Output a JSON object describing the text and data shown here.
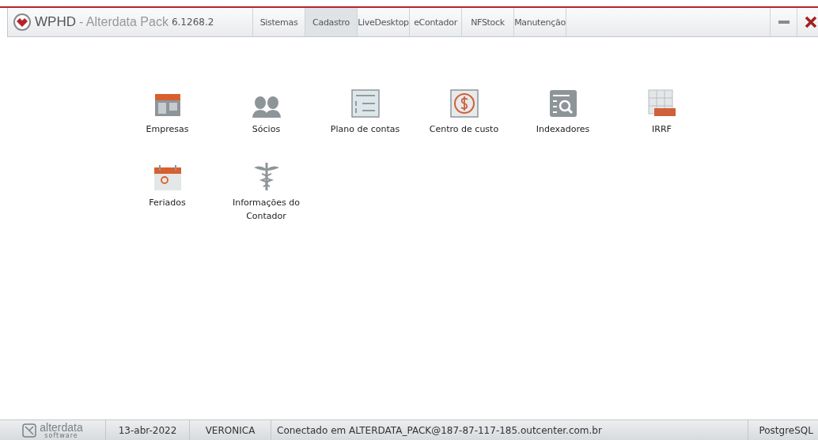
{
  "title_bar": {
    "app_name": "WPHD",
    "app_subtitle": "- Alterdata Pack",
    "version": "6.1268.2"
  },
  "tabs": [
    {
      "label": "Sistemas",
      "selected": false
    },
    {
      "label": "Cadastro",
      "selected": true
    },
    {
      "label": "LiveDesktop",
      "selected": false
    },
    {
      "label": "eContador",
      "selected": false
    },
    {
      "label": "NFStock",
      "selected": false
    },
    {
      "label": "Manutenção",
      "selected": false
    }
  ],
  "items": [
    {
      "label": "Empresas",
      "kind": "store"
    },
    {
      "label": "Sócios",
      "kind": "people"
    },
    {
      "label": "Plano de contas",
      "kind": "list"
    },
    {
      "label": "Centro de custo",
      "kind": "coin"
    },
    {
      "label": "Indexadores",
      "kind": "search"
    },
    {
      "label": "IRRF",
      "kind": "table"
    },
    {
      "label": "Feriados",
      "kind": "calendar"
    },
    {
      "label": "Informações do Contador",
      "kind": "caduceus"
    }
  ],
  "status_bar": {
    "logo_text": "alterdata",
    "logo_sub": "software",
    "date": "13-abr-2022",
    "user": "VERONICA",
    "connection": "Conectado em ALTERDATA_PACK@187-87-117-185.outcenter.com.br",
    "database": "PostgreSQL"
  }
}
